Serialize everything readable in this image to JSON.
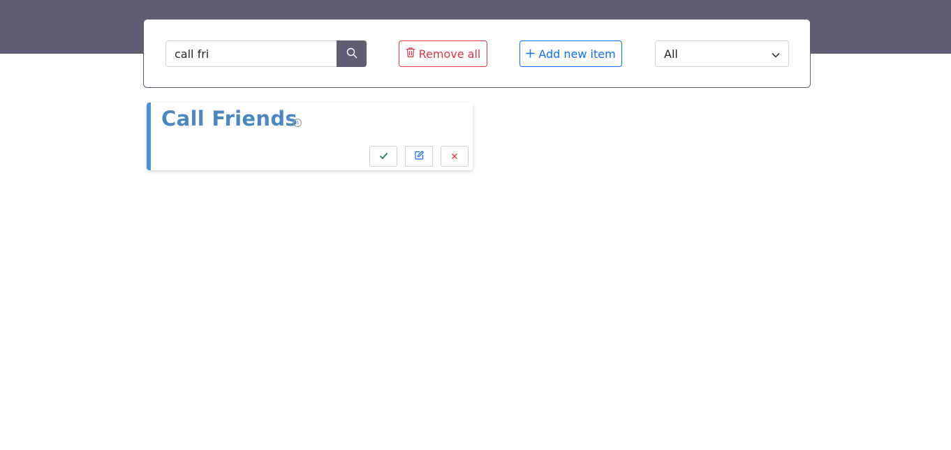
{
  "search": {
    "value": "call fri",
    "button_icon": "search-icon"
  },
  "toolbar": {
    "remove_all_label": "Remove all",
    "remove_all_icon": "trash-icon",
    "add_new_label": "Add new item",
    "add_new_icon": "plus-icon",
    "filter_selected": "All"
  },
  "todos": [
    {
      "title": "Call Friends",
      "status_icon": "clock-icon",
      "actions": [
        "check-icon",
        "edit-icon",
        "close-icon"
      ]
    }
  ],
  "colors": {
    "header": "#5f5d72",
    "danger": "#dc3545",
    "primary": "#0d6efd",
    "card_accent": "#4a90d6",
    "title": "#4a88c4",
    "success": "#198754"
  }
}
